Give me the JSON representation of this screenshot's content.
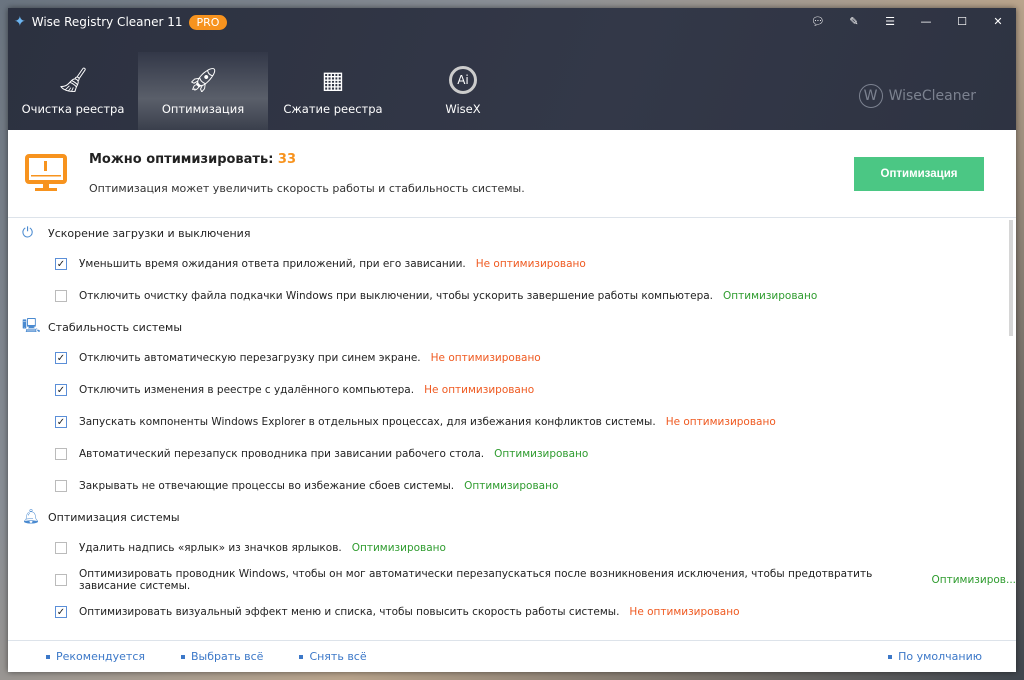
{
  "app": {
    "title": "Wise Registry Cleaner 11",
    "badge": "PRO",
    "brand": "WiseCleaner",
    "brand_letter": "W"
  },
  "window_controls": [
    "feedback-icon",
    "notes-icon",
    "menu-icon",
    "minimize-icon",
    "maximize-icon",
    "close-icon"
  ],
  "tabs": [
    {
      "label": "Очистка реестра",
      "icon": "broom-icon"
    },
    {
      "label": "Оптимизация",
      "icon": "rocket-icon",
      "active": true
    },
    {
      "label": "Сжатие реестра",
      "icon": "grid-icon"
    },
    {
      "label": "WiseX",
      "icon": "ai-icon"
    }
  ],
  "summary": {
    "title": "Можно оптимизировать:",
    "count": "33",
    "description": "Оптимизация может увеличить скорость работы и стабильность системы.",
    "button": "Оптимизация",
    "accent": "#f7931e",
    "button_color": "#4bc784"
  },
  "sections": [
    {
      "title": "Ускорение загрузки и выключения",
      "icon": "power-icon",
      "items": [
        {
          "text": "Уменьшить время ожидания ответа приложений, при его зависании.",
          "checked": true,
          "status": "Не оптимизировано",
          "ok": false
        },
        {
          "text": "Отключить очистку файла подкачки Windows при выключении, чтобы ускорить завершение работы компьютера.",
          "checked": false,
          "status": "Оптимизировано",
          "ok": true
        }
      ]
    },
    {
      "title": "Стабильность системы",
      "icon": "monitor-icon",
      "items": [
        {
          "text": "Отключить автоматическую перезагрузку при синем экране.",
          "checked": true,
          "status": "Не оптимизировано",
          "ok": false
        },
        {
          "text": "Отключить изменения в реестре с удалённого компьютера.",
          "checked": true,
          "status": "Не оптимизировано",
          "ok": false
        },
        {
          "text": "Запускать компоненты Windows Explorer в отдельных процессах, для избежания конфликтов системы.",
          "checked": true,
          "status": "Не оптимизировано",
          "ok": false
        },
        {
          "text": "Автоматический перезапуск проводника при зависании рабочего стола.",
          "checked": false,
          "status": "Оптимизировано",
          "ok": true
        },
        {
          "text": "Закрывать не отвечающие процессы во избежание сбоев системы.",
          "checked": false,
          "status": "Оптимизировано",
          "ok": true
        }
      ]
    },
    {
      "title": "Оптимизация системы",
      "icon": "bell-icon",
      "items": [
        {
          "text": "Удалить надпись «ярлык» из значков ярлыков.",
          "checked": false,
          "status": "Оптимизировано",
          "ok": true
        },
        {
          "text": "Оптимизировать проводник Windows, чтобы он мог автоматически перезапускаться после возникновения исключения, чтобы предотвратить зависание системы.",
          "checked": false,
          "status": "Оптимизиров...",
          "ok": true
        },
        {
          "text": "Оптимизировать визуальный эффект меню и списка, чтобы повысить скорость работы системы.",
          "checked": true,
          "status": "Не оптимизировано",
          "ok": false
        }
      ]
    }
  ],
  "footer": {
    "recommended": "Рекомендуется",
    "select_all": "Выбрать всё",
    "deselect_all": "Снять всё",
    "default": "По умолчанию"
  }
}
